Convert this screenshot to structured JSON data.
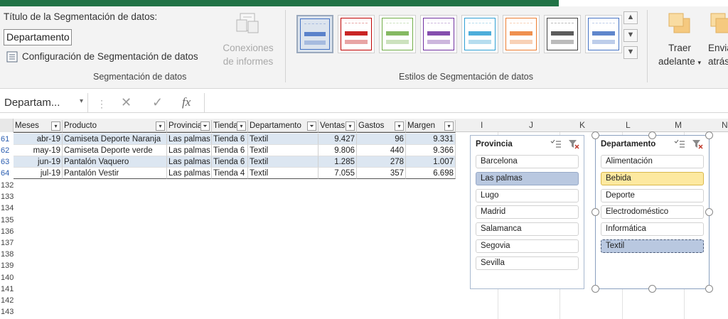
{
  "ribbon": {
    "title_label": "Título de la Segmentación de datos:",
    "title_value": "Departamento",
    "settings_label": "Configuración de Segmentación de datos",
    "connections_line1": "Conexiones",
    "connections_line2": "de informes",
    "group_slicer": "Segmentación de datos",
    "group_styles": "Estilos de Segmentación de datos",
    "bring_forward_line1": "Traer",
    "bring_forward_line2": "adelante",
    "send_backward_line1": "Enviar",
    "send_backward_line2": "atrás",
    "style_colors": [
      "#4472c4",
      "#c00000",
      "#70ad47",
      "#7030a0",
      "#2e9fd4",
      "#ed7d31",
      "#404040",
      "#4472c4"
    ]
  },
  "formula_bar": {
    "name_box": "Departam...",
    "cancel_symbol": "✕",
    "enter_symbol": "✓",
    "fx_symbol": "fx",
    "content": ""
  },
  "sheet": {
    "column_letters": [
      "I",
      "J",
      "K",
      "L",
      "M",
      "N"
    ],
    "headers": [
      "Meses",
      "Producto",
      "Provincia",
      "Tienda",
      "Departamento",
      "Ventas",
      "Gastos",
      "Margen"
    ],
    "rows": [
      {
        "row": "61",
        "cells": [
          "abr-19",
          "Camiseta Deporte Naranja",
          "Las palmas",
          "Tienda 6",
          "Textil",
          "9.427",
          "96",
          "9.331"
        ]
      },
      {
        "row": "62",
        "cells": [
          "may-19",
          "Camiseta Deporte verde",
          "Las palmas",
          "Tienda 6",
          "Textil",
          "9.806",
          "440",
          "9.366"
        ]
      },
      {
        "row": "63",
        "cells": [
          "jun-19",
          "Pantalón Vaquero",
          "Las palmas",
          "Tienda 6",
          "Textil",
          "1.285",
          "278",
          "1.007"
        ]
      },
      {
        "row": "64",
        "cells": [
          "jul-19",
          "Pantalón Vestir",
          "Las palmas",
          "Tienda 4",
          "Textil",
          "7.055",
          "357",
          "6.698"
        ]
      }
    ],
    "empty_rows": [
      "132",
      "133",
      "134",
      "135",
      "136",
      "137",
      "138",
      "139",
      "140",
      "141",
      "142",
      "143"
    ]
  },
  "slicer_provincia": {
    "title": "Provincia",
    "items": [
      "Barcelona",
      "Las palmas",
      "Lugo",
      "Madrid",
      "Salamanca",
      "Segovia",
      "Sevilla"
    ],
    "selected": "Las palmas"
  },
  "slicer_departamento": {
    "title": "Departamento",
    "items": [
      "Alimentación",
      "Bebida",
      "Deporte",
      "Electrodoméstico",
      "Informática",
      "Textil"
    ],
    "selected": "Textil"
  }
}
